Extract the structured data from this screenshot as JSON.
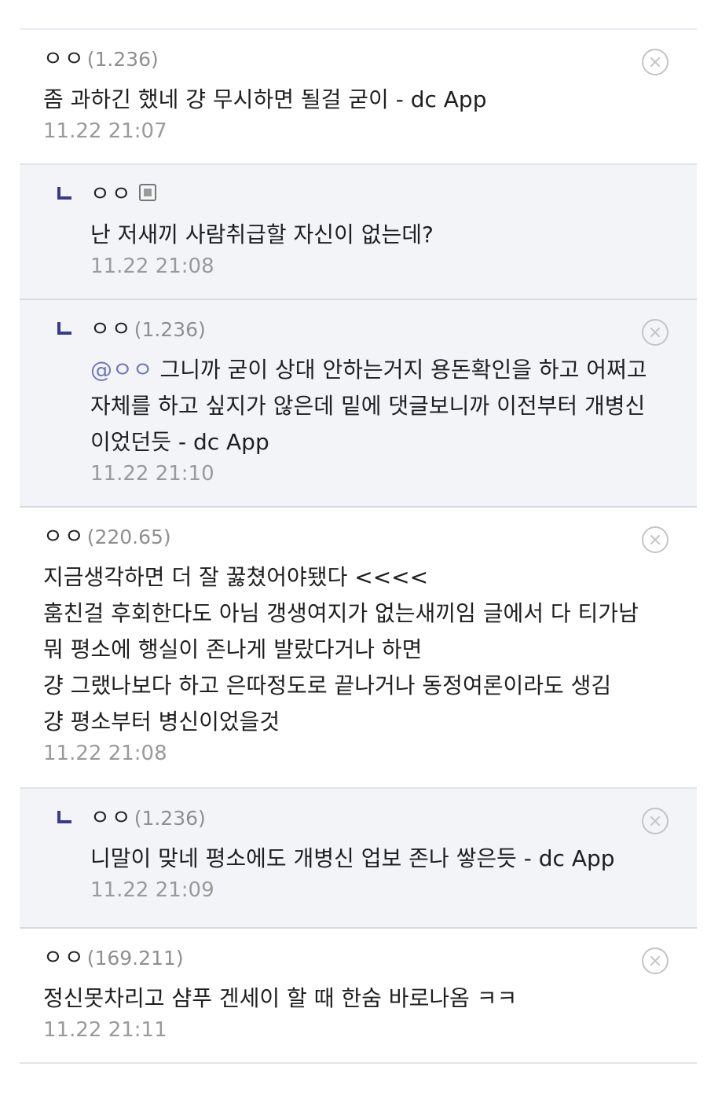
{
  "comments": [
    {
      "type": "top",
      "nick": "ㅇㅇ",
      "ip": "(1.236)",
      "text": "좀 과하긴 했네 걍 무시하면 될걸 굳이 - dc App",
      "time": "11.22 21:07",
      "deletable": true
    },
    {
      "type": "reply",
      "nick": "ㅇㅇ",
      "member_icon": "member-badge-icon",
      "text": "난 저새끼 사람취급할 자신이 없는데?",
      "time": "11.22 21:08",
      "deletable": false
    },
    {
      "type": "reply",
      "nick": "ㅇㅇ",
      "ip": "(1.236)",
      "mention": "@ㅇㅇ",
      "text": "그니까 굳이 상대 안하는거지 용돈확인을 하고 어쩌고\n자체를 하고 싶지가 않은데 밑에 댓글보니까 이전부터 개병신\n이었던듯 - dc App",
      "time": "11.22 21:10",
      "deletable": true
    },
    {
      "type": "top",
      "nick": "ㅇㅇ",
      "ip": "(220.65)",
      "text": "지금생각하면 더 잘 꿇쳤어야됐다 <<<<\n훔친걸 후회한다도 아님 갱생여지가 없는새끼임 글에서 다 티가남\n뭐 평소에 행실이 존나게 발랐다거나 하면\n걍 그랬나보다 하고 은따정도로 끝나거나 동정여론이라도 생김\n걍 평소부터 병신이었을것",
      "time": "11.22 21:08",
      "deletable": true
    },
    {
      "type": "reply",
      "nick": "ㅇㅇ",
      "ip": "(1.236)",
      "text": "니말이 맞네 평소에도 개병신 업보 존나 쌓은듯 - dc App",
      "time": "11.22 21:09",
      "deletable": true
    },
    {
      "type": "top",
      "nick": "ㅇㅇ",
      "ip": "(169.211)",
      "text": "정신못차리고 샴푸 겐세이 할 때 한숨 바로나옴 ㅋㅋ",
      "time": "11.22 21:11",
      "deletable": true
    }
  ]
}
